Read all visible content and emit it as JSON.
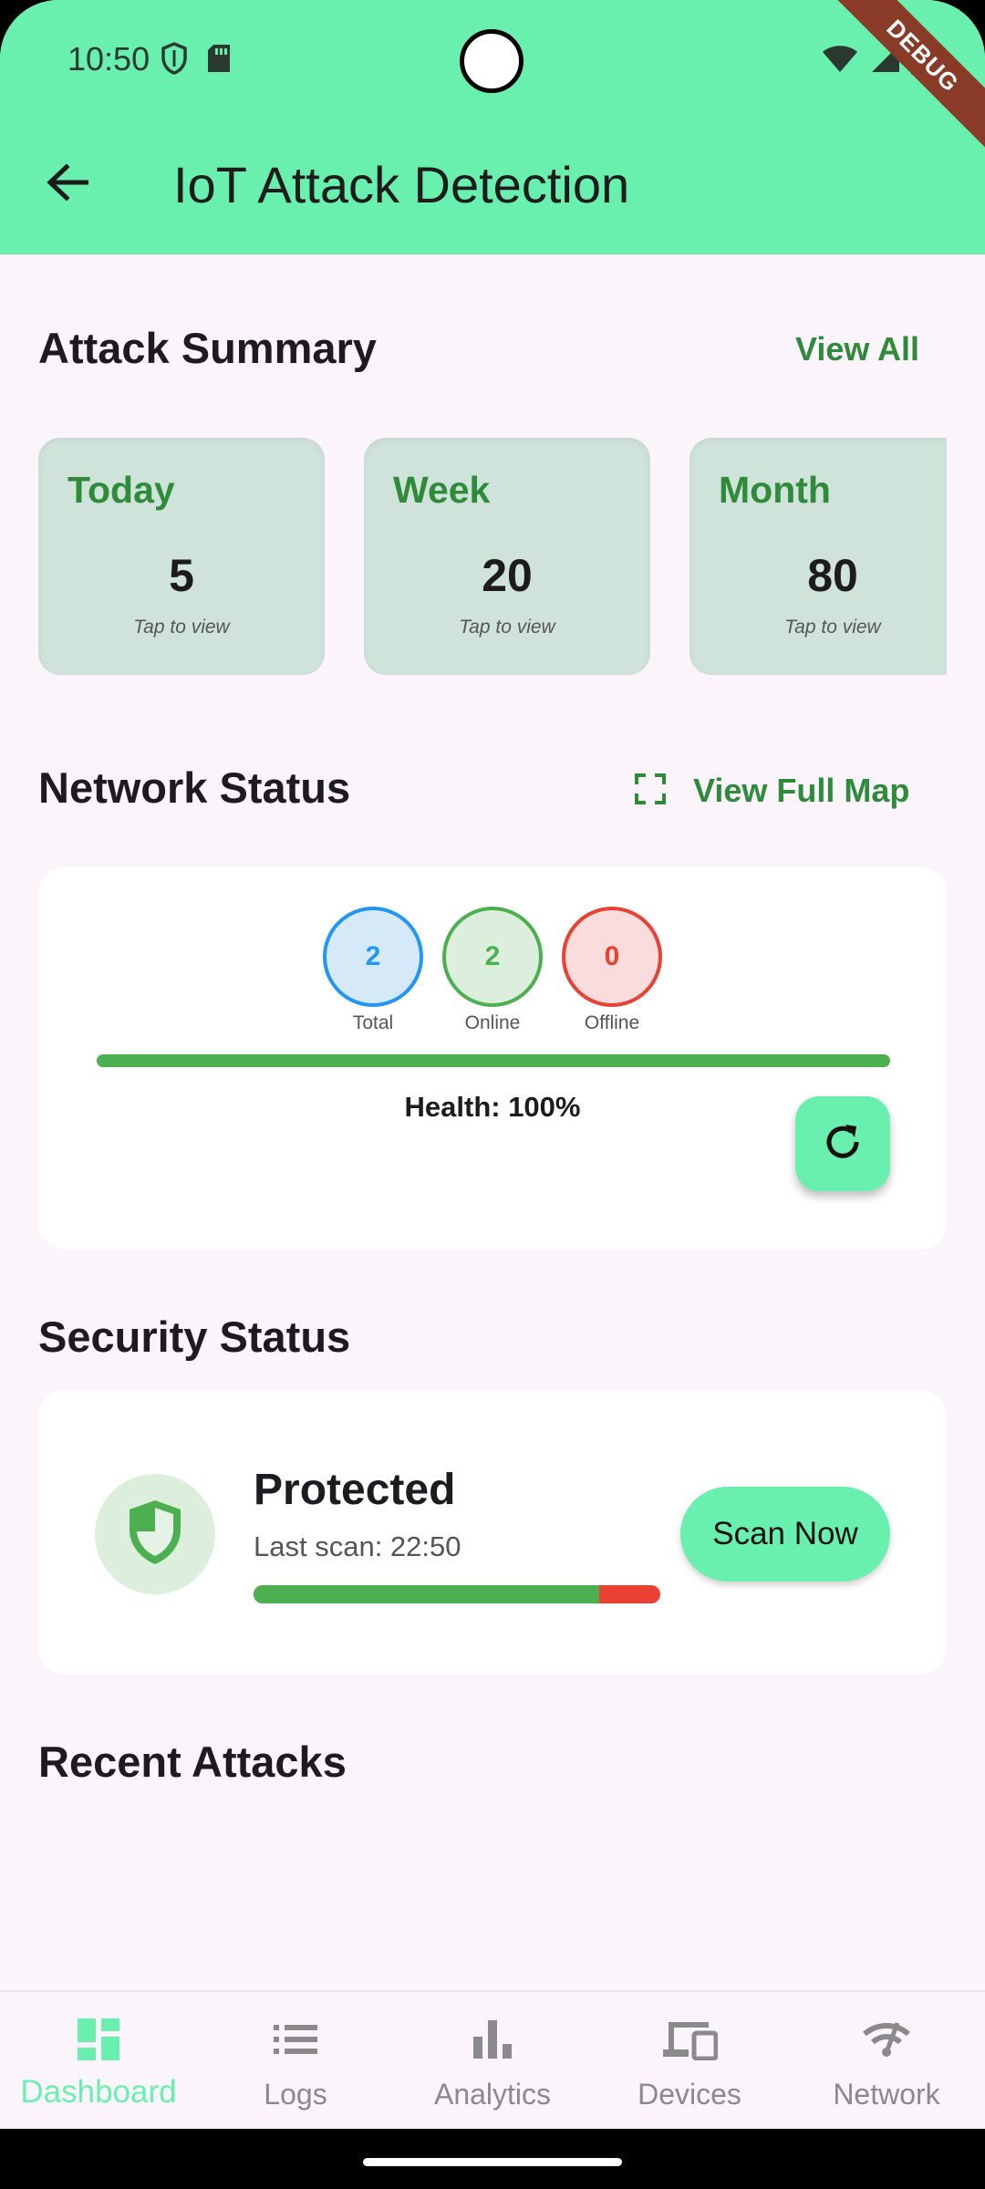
{
  "status_bar": {
    "time": "10:50",
    "icons_left": [
      "shield-icon",
      "sd-card-icon"
    ],
    "icons_right": [
      "wifi-icon",
      "signal-icon",
      "battery-icon"
    ]
  },
  "debug_badge": "DEBUG",
  "app_bar": {
    "title": "IoT Attack Detection",
    "back_icon": "arrow-back-icon"
  },
  "attack_summary": {
    "title": "Attack Summary",
    "view_all": "View All",
    "cards": [
      {
        "label": "Today",
        "value": "5",
        "hint": "Tap to view"
      },
      {
        "label": "Week",
        "value": "20",
        "hint": "Tap to view"
      },
      {
        "label": "Month",
        "value": "80",
        "hint": "Tap to view"
      }
    ]
  },
  "network_status": {
    "title": "Network Status",
    "view_map": "View Full Map",
    "map_icon": "fullscreen-icon",
    "counters": [
      {
        "value": "2",
        "label": "Total",
        "color": "#2196f3",
        "bg": "#d6e9f9"
      },
      {
        "value": "2",
        "label": "Online",
        "color": "#4caf50",
        "bg": "#dcefdd"
      },
      {
        "value": "0",
        "label": "Offline",
        "color": "#e94235",
        "bg": "#fbdcdc"
      }
    ],
    "health_percent": 100,
    "health_text": "Health: 100%",
    "refresh_icon": "refresh-icon"
  },
  "security_status": {
    "title": "Security Status",
    "state": "Protected",
    "last_scan": "Last scan: 22:50",
    "scan_progress": 0.85,
    "scan_button": "Scan Now",
    "shield_icon": "shield-icon"
  },
  "recent_attacks": {
    "title": "Recent Attacks"
  },
  "bottom_nav": [
    {
      "label": "Dashboard",
      "icon": "dashboard-icon",
      "active": true
    },
    {
      "label": "Logs",
      "icon": "list-icon",
      "active": false
    },
    {
      "label": "Analytics",
      "icon": "bar-chart-icon",
      "active": false
    },
    {
      "label": "Devices",
      "icon": "devices-icon",
      "active": false
    },
    {
      "label": "Network",
      "icon": "network-icon",
      "active": false
    }
  ],
  "colors": {
    "accent": "#69f0ae",
    "link": "#2e8b3a",
    "background": "#fcf4fb"
  }
}
